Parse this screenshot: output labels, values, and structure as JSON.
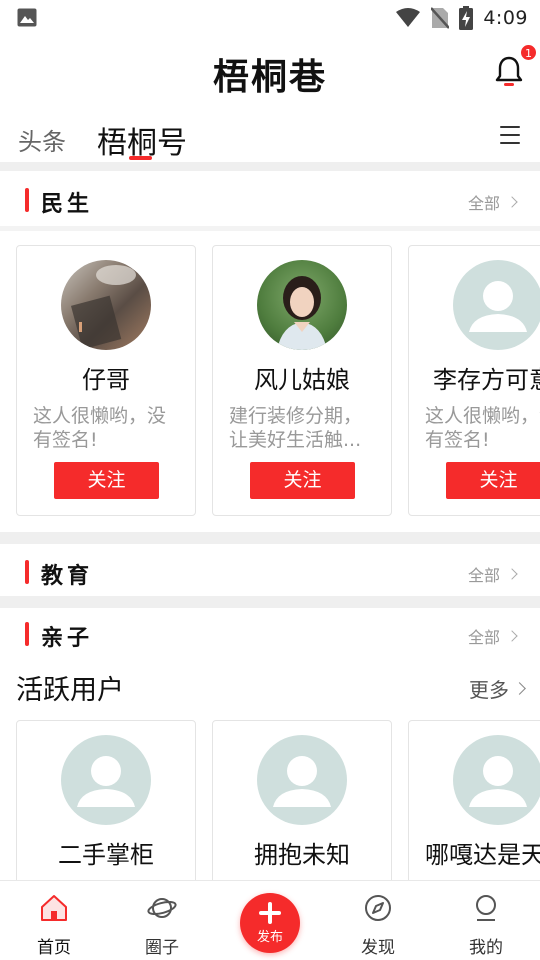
{
  "status_bar": {
    "time": "4:09",
    "icons": [
      "image-icon",
      "wifi-icon",
      "no-sim-icon",
      "battery-charging-icon"
    ]
  },
  "header": {
    "title": "梧桐巷",
    "notification_count": "1"
  },
  "tabs": [
    {
      "label": "头条",
      "active": false
    },
    {
      "label": "梧桐号",
      "active": true
    }
  ],
  "sections": [
    {
      "title": "民生",
      "all_label": "全部"
    },
    {
      "title": "教育",
      "all_label": "全部"
    },
    {
      "title": "亲子",
      "all_label": "全部"
    }
  ],
  "minsheng_cards": [
    {
      "name": "仔哥",
      "desc": "这人很懒哟，没有签名!",
      "follow_label": "关注",
      "avatar": "photo"
    },
    {
      "name": "风儿姑娘",
      "desc": "建行装修分期，让美好生活触...",
      "follow_label": "关注",
      "avatar": "photo"
    },
    {
      "name": "李存方可意",
      "desc": "这人很懒哟，没有签名!",
      "follow_label": "关注",
      "avatar": "default"
    }
  ],
  "active_users": {
    "title": "活跃用户",
    "more_label": "更多",
    "cards": [
      {
        "name": "二手掌柜"
      },
      {
        "name": "拥抱未知"
      },
      {
        "name": "哪嘎达是天"
      }
    ]
  },
  "bottom_nav": [
    {
      "label": "首页",
      "icon": "home-icon",
      "active": true
    },
    {
      "label": "圈子",
      "icon": "planet-icon",
      "active": false
    },
    {
      "label": "发布",
      "icon": "plus-icon",
      "active": false
    },
    {
      "label": "发现",
      "icon": "compass-icon",
      "active": false
    },
    {
      "label": "我的",
      "icon": "profile-icon",
      "active": false
    }
  ],
  "colors": {
    "accent": "#f52b2b",
    "muted_text": "#999999",
    "separator": "#efefef",
    "avatar_placeholder": "#cfdfdd"
  }
}
